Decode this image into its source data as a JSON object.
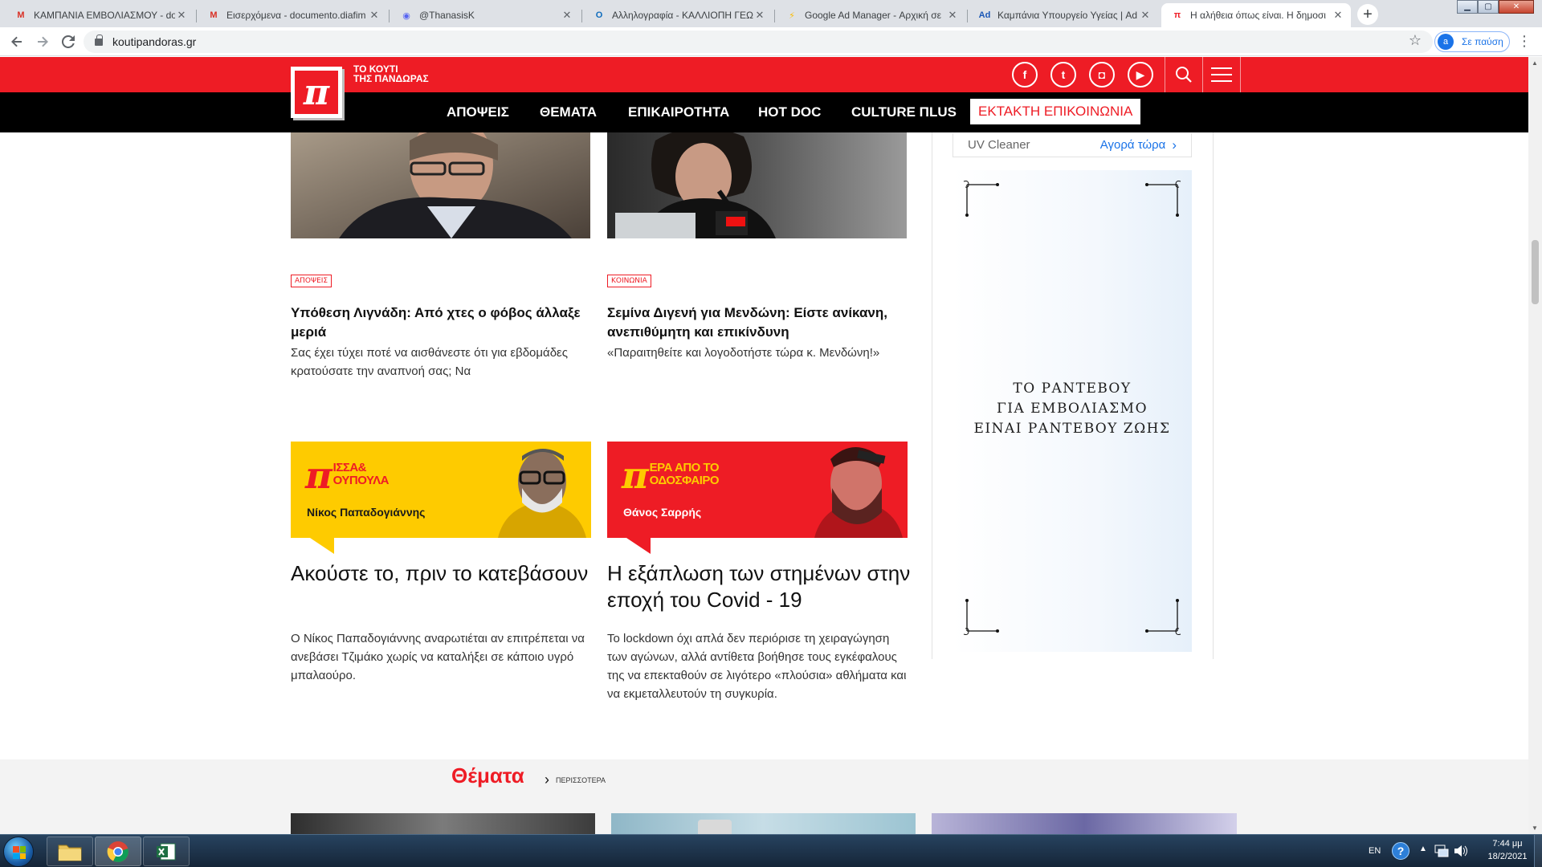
{
  "browser": {
    "tabs": [
      {
        "title": "ΚΑΜΠΑΝΙΑ ΕΜΒΟΛΙΑΣΜΟΥ - do",
        "icon": "gmail-icon",
        "fav": "M",
        "fav_color": "#d93025"
      },
      {
        "title": "Εισερχόμενα - documento.diafim",
        "icon": "gmail-icon",
        "fav": "M",
        "fav_color": "#d93025"
      },
      {
        "title": "@ThanasisK",
        "icon": "discord-icon",
        "fav": "◉",
        "fav_color": "#5865f2"
      },
      {
        "title": "Αλληλογραφία - ΚΑΛΛΙΟΠΗ ΓΕΩ",
        "icon": "outlook-icon",
        "fav": "O",
        "fav_color": "#0f6cbd"
      },
      {
        "title": "Google Ad Manager - Αρχική σε",
        "icon": "ad-manager-icon",
        "fav": "⚡",
        "fav_color": "#fbbc04"
      },
      {
        "title": "Καμπάνια Υπουργείο Υγείας | Ad",
        "icon": "ad-icon",
        "fav": "Ad",
        "fav_color": "#1a57b6"
      },
      {
        "title": "Η αλήθεια όπως είναι. Η δημοσι",
        "icon": "pi-icon",
        "fav": "π",
        "fav_color": "#ee1c25"
      }
    ],
    "new_tab": "+",
    "url": "koutipandoras.gr",
    "profile_initial": "a",
    "profile_label": "Σε παύση"
  },
  "site": {
    "logo_letter": "π",
    "logo_line1": "ΤΟ ΚΟΥΤΙ",
    "logo_line2": "ΤΗΣ ΠΑΝΔΩΡΑΣ",
    "social": [
      {
        "name": "facebook-icon",
        "glyph": "f"
      },
      {
        "name": "twitter-icon",
        "glyph": "t"
      },
      {
        "name": "instagram-icon",
        "glyph": "◘"
      },
      {
        "name": "youtube-icon",
        "glyph": "▶"
      }
    ],
    "nav": [
      "ΑΠΟΨΕΙΣ",
      "ΘΕΜΑΤΑ",
      "ΕΠΙΚΑΙΡΟΤΗΤΑ",
      "HOT DOC",
      "CULTURE ΠLUS"
    ],
    "nav_hot": "ΕΚΤΑΚΤΗ ΕΠΙΚΟΙΝΩΝΙΑ",
    "accent": "#ee1c25"
  },
  "articles": [
    {
      "category": "ΑΠΟΨΕΙΣ",
      "title": "Υπόθεση Λιγνάδη: Από χτες ο φόβος άλλαξε μεριά",
      "summary": "Σας έχει τύχει ποτέ να αισθάνεστε ότι για εβδομάδες κρατούσατε την αναπνοή σας; Να"
    },
    {
      "category": "ΚΟΙΝΩΝΙΑ",
      "title": "Σεμίνα Διγενή για Μενδώνη: Είστε ανίκανη, ανεπιθύμητη και επικίνδυνη",
      "summary": "«Παραιτηθείτε και λογοδοτήστε τώρα κ. Μενδώνη!»"
    }
  ],
  "columns": [
    {
      "logo_line1": "ΙΣΣΑ&",
      "logo_line2": "ΟΥΠΟΥΛΑ",
      "author": "Νίκος Παπαδογιάννης",
      "color": "#fecb00",
      "text_color": "#ee1c25",
      "author_color": "#1a1a1a",
      "title": "Ακούστε το, πριν το κατεβάσουν",
      "summary": "Ο Νίκος Παπαδογιάννης αναρωτιέται αν επιτρέπεται να ανεβάσει Τζιμάκο χωρίς να καταλήξει σε κάποιο υγρό μπαλαούρο."
    },
    {
      "logo_line1": "ΕΡΑ ΑΠΟ ΤΟ",
      "logo_line2": "ΟΔΟΣΦΑΙΡΟ",
      "author": "Θάνος Σαρρής",
      "color": "#ee1c25",
      "text_color": "#fecb00",
      "author_color": "#ffffff",
      "title": "Η εξάπλωση των στημένων στην εποχή του Covid - 19",
      "summary": "Το lockdown όχι απλά δεν περιόρισε τη χειραγώγηση των αγώνων, αλλά αντίθετα βοήθησε τους εγκέφαλους της να επεκταθούν σε λιγότερο «πλούσια» αθλήματα και να εκμεταλλευτούν τη συγκυρία."
    }
  ],
  "sidebar": {
    "ad_product": "UV Cleaner",
    "ad_cta": "Αγορά τώρα",
    "vax_line1": "ΤΟ ΡΑΝΤΕΒΟΥ",
    "vax_line2": "ΓΙΑ ΕΜΒΟΛΙΑΣΜΟ",
    "vax_line3": "ΕΙΝΑΙ ΡΑΝΤΕΒΟΥ ΖΩΗΣ"
  },
  "section": {
    "title": "Θέματα",
    "more": "ΠΕΡΙΣΣΟΤΕΡΑ"
  },
  "taskbar": {
    "lang": "EN",
    "time": "7:44 μμ",
    "date": "18/2/2021"
  }
}
